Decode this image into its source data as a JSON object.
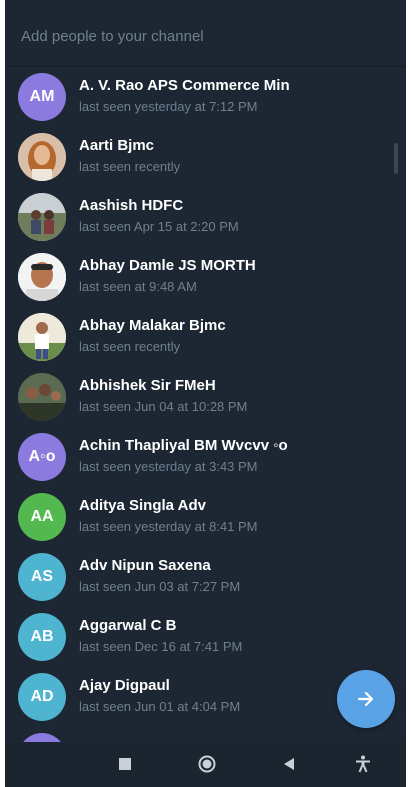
{
  "search": {
    "placeholder": "Add people to your channel"
  },
  "contacts": [
    {
      "name": "A. V. Rao APS Commerce Min",
      "status": "last seen yesterday at 7:12 PM",
      "initials": "AM",
      "color": "#8c7bde"
    },
    {
      "name": "Aarti Bjmc",
      "status": "last seen recently",
      "photo": "portrait-woman"
    },
    {
      "name": "Aashish HDFC",
      "status": "last seen Apr 15 at 2:20 PM",
      "photo": "outdoor-group"
    },
    {
      "name": "Abhay Damle JS MORTH",
      "status": "last seen at 9:48 AM",
      "photo": "portrait-man"
    },
    {
      "name": "Abhay Malakar Bjmc",
      "status": "last seen recently",
      "photo": "man-white-shirt"
    },
    {
      "name": "Abhishek Sir FMeH",
      "status": "last seen Jun 04 at 10:28 PM",
      "photo": "group-photo"
    },
    {
      "name": "Achin Thapliyal BM Wvcvv ◦o",
      "status": "last seen yesterday at 3:43 PM",
      "initials": "A◦o",
      "color": "#8c7bde"
    },
    {
      "name": "Aditya Singla Adv",
      "status": "last seen yesterday at 8:41 PM",
      "initials": "AA",
      "color": "#52b84f"
    },
    {
      "name": "Adv Nipun Saxena",
      "status": "last seen Jun 03 at 7:27 PM",
      "initials": "AS",
      "color": "#4fb4cf"
    },
    {
      "name": "Aggarwal C B",
      "status": "last seen Dec 16 at 7:41 PM",
      "initials": "AB",
      "color": "#4fb4cf"
    },
    {
      "name": "Ajay Digpaul",
      "status": "last seen Jun 01 at 4:04 PM",
      "initials": "AD",
      "color": "#4fb4cf"
    },
    {
      "name": "",
      "status": "",
      "initials": "",
      "color": "#8c7bde"
    }
  ],
  "fab": {
    "icon": "arrow-right-icon",
    "color": "#5aa2e6"
  },
  "navigation": {
    "buttons": [
      "recents-icon",
      "home-icon",
      "back-icon",
      "accessibility-icon"
    ]
  },
  "theme": {
    "background": "#1d2733",
    "secondary_text": "#6f7f8f"
  }
}
